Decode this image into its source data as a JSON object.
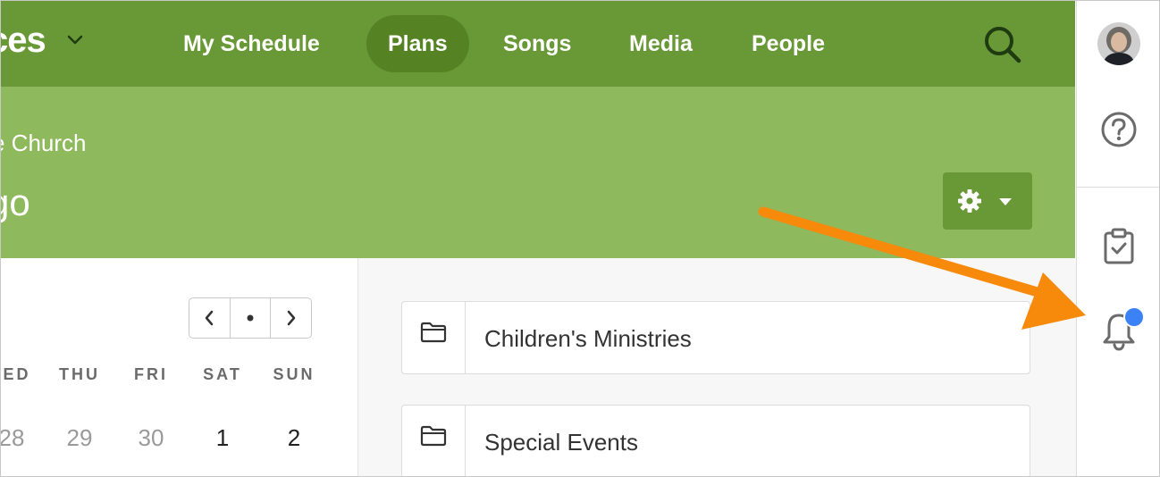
{
  "app": {
    "brand_fragment": "ces",
    "nav": [
      {
        "label": "My Schedule",
        "active": false
      },
      {
        "label": "Plans",
        "active": true
      },
      {
        "label": "Songs",
        "active": false
      },
      {
        "label": "Media",
        "active": false
      },
      {
        "label": "People",
        "active": false
      }
    ]
  },
  "header": {
    "org_fragment": "e Church",
    "title_fragment": "go"
  },
  "calendar": {
    "weekdays": [
      "ED",
      "THU",
      "FRI",
      "SAT",
      "SUN"
    ],
    "days": [
      {
        "label": "28",
        "muted": true
      },
      {
        "label": "29",
        "muted": true
      },
      {
        "label": "30",
        "muted": true
      },
      {
        "label": "1",
        "muted": false
      },
      {
        "label": "2",
        "muted": false
      }
    ]
  },
  "folders": [
    {
      "label": "Children's Ministries"
    },
    {
      "label": "Special Events"
    }
  ],
  "rail": {
    "icons": [
      "avatar",
      "help-icon",
      "tasks-icon",
      "bell-icon"
    ],
    "notification_dot": true
  },
  "colors": {
    "nav_bg": "#699937",
    "nav_active": "#558223",
    "header_bg": "#8eb95c",
    "annotation_arrow": "#f7890b",
    "notification": "#3b82f6"
  }
}
